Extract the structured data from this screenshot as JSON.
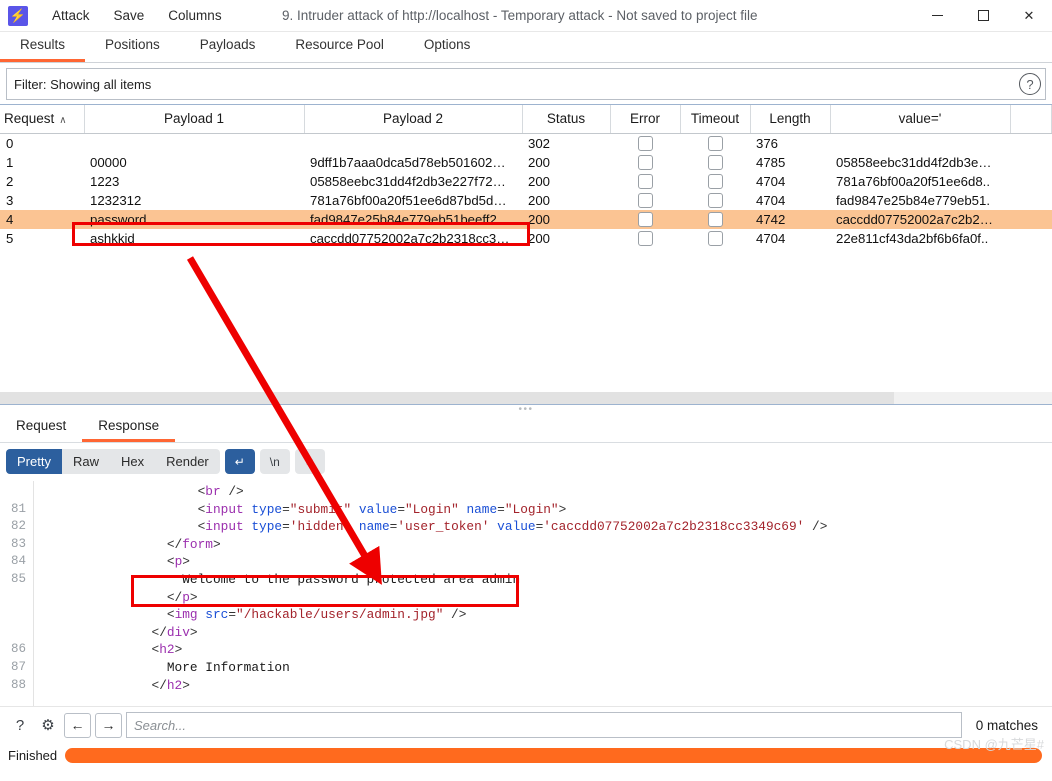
{
  "window": {
    "logo_glyph": "⚡",
    "title": "9. Intruder attack of http://localhost - Temporary attack - Not saved to project file",
    "menus": [
      "Attack",
      "Save",
      "Columns"
    ],
    "controls": {
      "minimize": "minimize-icon",
      "maximize": "maximize-icon",
      "close": "✕"
    }
  },
  "main_tabs": [
    {
      "label": "Results",
      "active": true
    },
    {
      "label": "Positions",
      "active": false
    },
    {
      "label": "Payloads",
      "active": false
    },
    {
      "label": "Resource Pool",
      "active": false
    },
    {
      "label": "Options",
      "active": false
    }
  ],
  "filter": {
    "text": "Filter: Showing all items",
    "help_glyph": "?"
  },
  "results_table": {
    "columns": [
      "Request",
      "Payload 1",
      "Payload 2",
      "Status",
      "Error",
      "Timeout",
      "Length",
      "value='"
    ],
    "sort_caret": "∧",
    "rows": [
      {
        "request": "0",
        "payload1": "",
        "payload2": "",
        "status": "302",
        "error": false,
        "timeout": false,
        "length": "376",
        "value": "",
        "highlight": false
      },
      {
        "request": "1",
        "payload1": "00000",
        "payload2": "9dff1b7aaa0dca5d78eb501602…",
        "status": "200",
        "error": false,
        "timeout": false,
        "length": "4785",
        "value": "05858eebc31dd4f2db3e…",
        "highlight": false
      },
      {
        "request": "2",
        "payload1": "1223",
        "payload2": "05858eebc31dd4f2db3e227f72…",
        "status": "200",
        "error": false,
        "timeout": false,
        "length": "4704",
        "value": "781a76bf00a20f51ee6d8..",
        "highlight": false
      },
      {
        "request": "3",
        "payload1": "1232312",
        "payload2": "781a76bf00a20f51ee6d87bd5d…",
        "status": "200",
        "error": false,
        "timeout": false,
        "length": "4704",
        "value": "fad9847e25b84e779eb51.",
        "highlight": false
      },
      {
        "request": "4",
        "payload1": "password",
        "payload2": "fad9847e25b84e779eb51beeff2.",
        "status": "200",
        "error": false,
        "timeout": false,
        "length": "4742",
        "value": "caccdd07752002a7c2b2…",
        "highlight": true
      },
      {
        "request": "5",
        "payload1": "ashkkjd",
        "payload2": "caccdd07752002a7c2b2318cc3…",
        "status": "200",
        "error": false,
        "timeout": false,
        "length": "4704",
        "value": "22e811cf43da2bf6b6fa0f..",
        "highlight": false
      }
    ]
  },
  "message_tabs": [
    {
      "label": "Request",
      "active": false
    },
    {
      "label": "Response",
      "active": true
    }
  ],
  "view_toolbar": {
    "modes": [
      {
        "label": "Pretty",
        "active": true
      },
      {
        "label": "Raw",
        "active": false
      },
      {
        "label": "Hex",
        "active": false
      },
      {
        "label": "Render",
        "active": false
      }
    ],
    "icons": [
      {
        "name": "word-wrap-icon",
        "glyph": "↵",
        "active": true
      },
      {
        "name": "newline-icon",
        "glyph": "\\n",
        "active": false
      },
      {
        "name": "format-lines-icon",
        "glyph": "≡",
        "active": false
      }
    ]
  },
  "code": {
    "lines": [
      {
        "num": "",
        "parts": [
          {
            "t": "partial",
            "v": ""
          }
        ]
      },
      {
        "num": "81",
        "indent": 10,
        "parts": [
          {
            "t": "pun",
            "v": "<"
          },
          {
            "t": "tag",
            "v": "br"
          },
          {
            "t": "pun",
            "v": " />"
          }
        ]
      },
      {
        "num": "82",
        "indent": 10,
        "parts": [
          {
            "t": "pun",
            "v": "<"
          },
          {
            "t": "tag",
            "v": "input"
          },
          {
            "t": "pun",
            "v": " "
          },
          {
            "t": "attr",
            "v": "type"
          },
          {
            "t": "pun",
            "v": "="
          },
          {
            "t": "val",
            "v": "\"submit\""
          },
          {
            "t": "pun",
            "v": " "
          },
          {
            "t": "attr",
            "v": "value"
          },
          {
            "t": "pun",
            "v": "="
          },
          {
            "t": "val",
            "v": "\"Login\""
          },
          {
            "t": "pun",
            "v": " "
          },
          {
            "t": "attr",
            "v": "name"
          },
          {
            "t": "pun",
            "v": "="
          },
          {
            "t": "val",
            "v": "\"Login\""
          },
          {
            "t": "pun",
            "v": ">"
          }
        ]
      },
      {
        "num": "83",
        "indent": 10,
        "parts": [
          {
            "t": "pun",
            "v": "<"
          },
          {
            "t": "tag",
            "v": "input"
          },
          {
            "t": "pun",
            "v": " "
          },
          {
            "t": "attr",
            "v": "type"
          },
          {
            "t": "pun",
            "v": "="
          },
          {
            "t": "val",
            "v": "'hidden'"
          },
          {
            "t": "pun",
            "v": " "
          },
          {
            "t": "attr",
            "v": "name"
          },
          {
            "t": "pun",
            "v": "="
          },
          {
            "t": "val",
            "v": "'user_token'"
          },
          {
            "t": "pun",
            "v": " "
          },
          {
            "t": "attr",
            "v": "value"
          },
          {
            "t": "pun",
            "v": "="
          },
          {
            "t": "val",
            "v": "'caccdd07752002a7c2b2318cc3349c69'"
          },
          {
            "t": "pun",
            "v": " />"
          }
        ]
      },
      {
        "num": "84",
        "indent": 8,
        "parts": [
          {
            "t": "pun",
            "v": "</"
          },
          {
            "t": "tag",
            "v": "form"
          },
          {
            "t": "pun",
            "v": ">"
          }
        ]
      },
      {
        "num": "85",
        "indent": 8,
        "parts": [
          {
            "t": "pun",
            "v": "<"
          },
          {
            "t": "tag",
            "v": "p"
          },
          {
            "t": "pun",
            "v": ">"
          }
        ]
      },
      {
        "num": "",
        "indent": 9,
        "parts": [
          {
            "t": "txt",
            "v": "Welcome to the password protected area admin"
          }
        ]
      },
      {
        "num": "",
        "indent": 8,
        "parts": [
          {
            "t": "pun",
            "v": "</"
          },
          {
            "t": "tag",
            "v": "p"
          },
          {
            "t": "pun",
            "v": ">"
          }
        ]
      },
      {
        "num": "",
        "indent": 8,
        "parts": [
          {
            "t": "pun",
            "v": "<"
          },
          {
            "t": "tag",
            "v": "img"
          },
          {
            "t": "pun",
            "v": " "
          },
          {
            "t": "attr",
            "v": "src"
          },
          {
            "t": "pun",
            "v": "="
          },
          {
            "t": "val",
            "v": "\"/hackable/users/admin.jpg\""
          },
          {
            "t": "pun",
            "v": " />"
          }
        ]
      },
      {
        "num": "86",
        "indent": 7,
        "parts": [
          {
            "t": "pun",
            "v": "</"
          },
          {
            "t": "tag",
            "v": "div"
          },
          {
            "t": "pun",
            "v": ">"
          }
        ]
      },
      {
        "num": "87",
        "indent": 0,
        "parts": [
          {
            "t": "pun",
            "v": ""
          }
        ]
      },
      {
        "num": "88",
        "indent": 7,
        "parts": [
          {
            "t": "pun",
            "v": "<"
          },
          {
            "t": "tag",
            "v": "h2"
          },
          {
            "t": "pun",
            "v": ">"
          }
        ]
      },
      {
        "num": "",
        "indent": 8,
        "parts": [
          {
            "t": "txt",
            "v": "More Information"
          }
        ]
      },
      {
        "num": "",
        "indent": 7,
        "parts": [
          {
            "t": "pun",
            "v": "</"
          },
          {
            "t": "tag",
            "v": "h2"
          },
          {
            "t": "pun",
            "v": ">"
          }
        ]
      }
    ]
  },
  "search_bar": {
    "help_glyph": "?",
    "settings_glyph": "⚙",
    "prev_glyph": "←",
    "next_glyph": "→",
    "placeholder": "Search...",
    "value": "",
    "matches": "0 matches"
  },
  "status_bar": {
    "text": "Finished",
    "progress_percent": 100
  },
  "watermark": "CSDN @九芒星#",
  "colors": {
    "accent": "#ff6633",
    "highlight_row": "#fbc493",
    "annotation": "#ee0000",
    "selected_seg": "#2c5f9e",
    "progress": "#ff6a1e"
  }
}
